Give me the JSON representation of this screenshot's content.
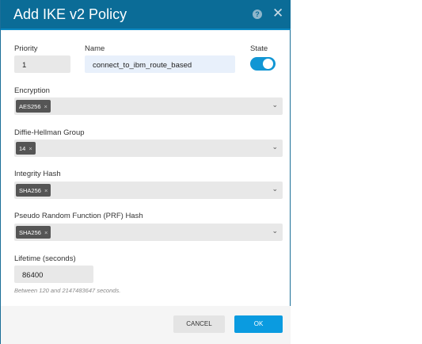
{
  "dialog": {
    "title": "Add IKE v2 Policy",
    "help_icon": "question-circle-icon",
    "close_icon": "close-icon"
  },
  "priority": {
    "label": "Priority",
    "value": "1"
  },
  "name": {
    "label": "Name",
    "value": "connect_to_ibm_route_based"
  },
  "state": {
    "label": "State",
    "enabled": true
  },
  "encryption": {
    "label": "Encryption",
    "chips": [
      "AES256"
    ]
  },
  "dh_group": {
    "label": "Diffie-Hellman Group",
    "chips": [
      "14"
    ]
  },
  "integrity": {
    "label": "Integrity Hash",
    "chips": [
      "SHA256"
    ]
  },
  "prf": {
    "label": "Pseudo Random Function (PRF) Hash",
    "chips": [
      "SHA256"
    ]
  },
  "lifetime": {
    "label": "Lifetime (seconds)",
    "value": "86400",
    "hint": "Between 120 and 2147483647 seconds."
  },
  "footer": {
    "cancel": "CANCEL",
    "ok": "OK"
  },
  "colors": {
    "header": "#0b6c97",
    "accent": "#1196d4"
  }
}
